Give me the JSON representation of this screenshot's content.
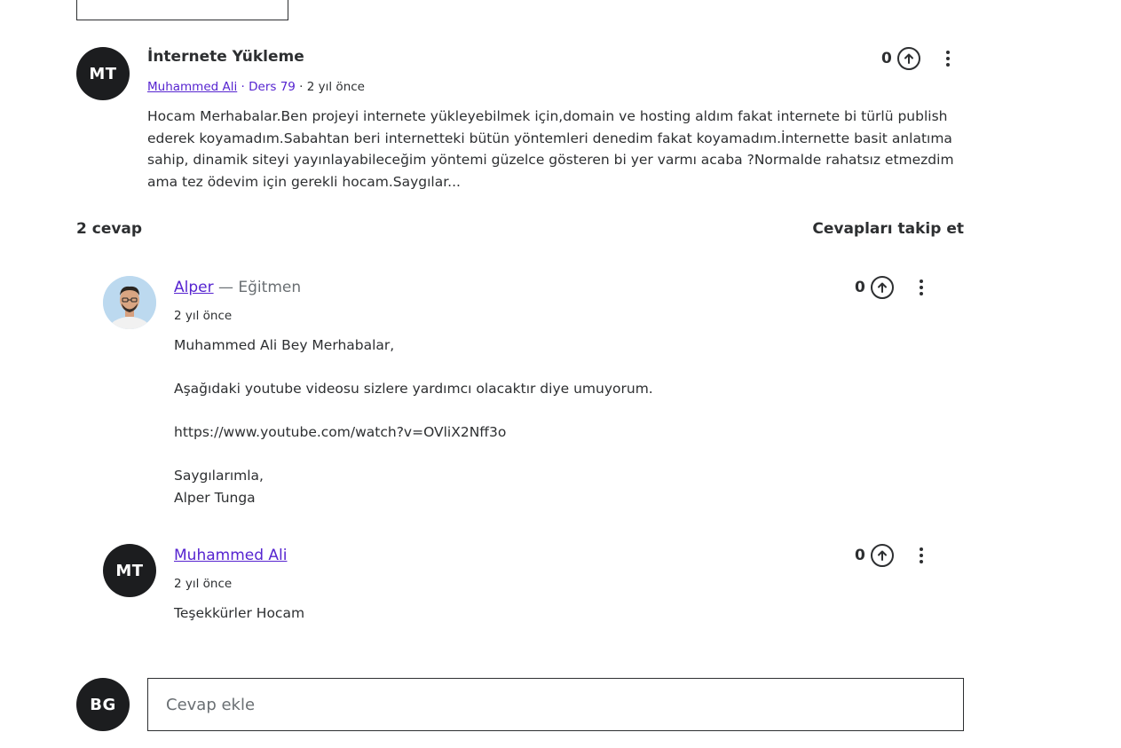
{
  "question": {
    "avatar_initials": "MT",
    "title": "İnternete Yükleme",
    "author": "Muhammed Ali",
    "lecture": "Ders 79",
    "time": "2 yıl önce",
    "body": "Hocam Merhabalar.Ben projeyi internete yükleyebilmek için,domain ve hosting aldım fakat internete bi türlü publish ederek koyamadım.Sabahtan beri internetteki bütün yöntemleri denedim fakat koyamadım.İnternette basit anlatıma sahip, dinamik siteyi yayınlayabileceğim yöntemi güzelce gösteren bi yer varmı acaba ?Normalde rahatsız etmezdim ama tez ödevim için gerekli hocam.Saygılar...",
    "votes": "0"
  },
  "answers_header": {
    "count_label": "2 cevap",
    "follow_label": "Cevapları takip et"
  },
  "answers": [
    {
      "author": "Alper",
      "role": " — Eğitmen",
      "time": "2 yıl önce",
      "votes": "0",
      "lines": [
        "Muhammed Ali Bey Merhabalar,",
        "",
        "Aşağıdaki youtube videosu sizlere yardımcı olacaktır diye umuyorum.",
        "",
        "https://www.youtube.com/watch?v=OVliX2Nff3o",
        "",
        "Saygılarımla,",
        "Alper Tunga"
      ]
    },
    {
      "avatar_initials": "MT",
      "author": "Muhammed Ali",
      "time": "2 yıl önce",
      "votes": "0",
      "lines": [
        "Teşekkürler Hocam"
      ]
    }
  ],
  "reply": {
    "avatar_initials": "BG",
    "placeholder": "Cevap ekle"
  },
  "colors": {
    "link": "#5624d0",
    "text": "#2d2f31",
    "avatar_bg": "#1c1d1f"
  }
}
